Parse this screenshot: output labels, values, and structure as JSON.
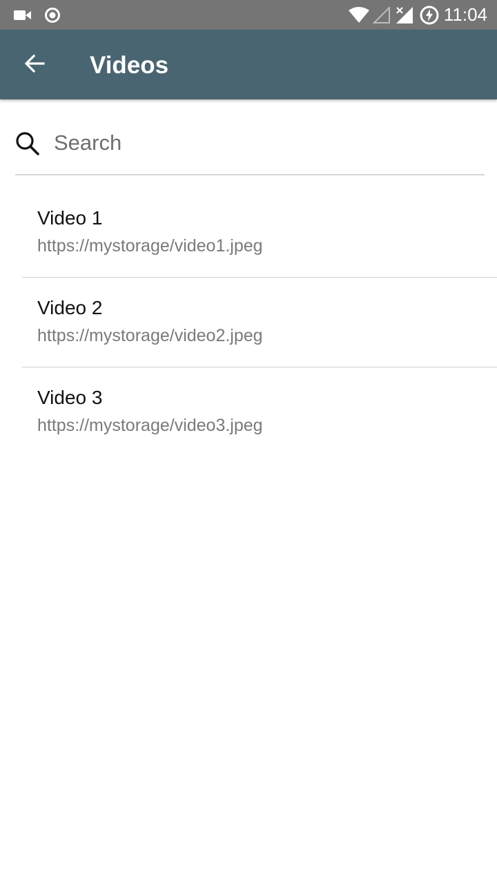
{
  "status_bar": {
    "time": "11:04",
    "icons": [
      "video-camera-icon",
      "record-icon",
      "wifi-icon",
      "signal-empty-icon",
      "signal-no-service-icon",
      "battery-charging-icon"
    ]
  },
  "app_bar": {
    "title": "Videos",
    "back_icon": "arrow-back-icon"
  },
  "search": {
    "placeholder": "Search",
    "value": "",
    "icon": "search-icon"
  },
  "videos": [
    {
      "title": "Video 1",
      "url": "https://mystorage/video1.jpeg"
    },
    {
      "title": "Video 2",
      "url": "https://mystorage/video2.jpeg"
    },
    {
      "title": "Video 3",
      "url": "https://mystorage/video3.jpeg"
    }
  ],
  "colors": {
    "status_bar": "#757575",
    "app_bar": "#4a6572",
    "title_text": "#ffffff",
    "subtitle_text": "#7a7a7a"
  }
}
